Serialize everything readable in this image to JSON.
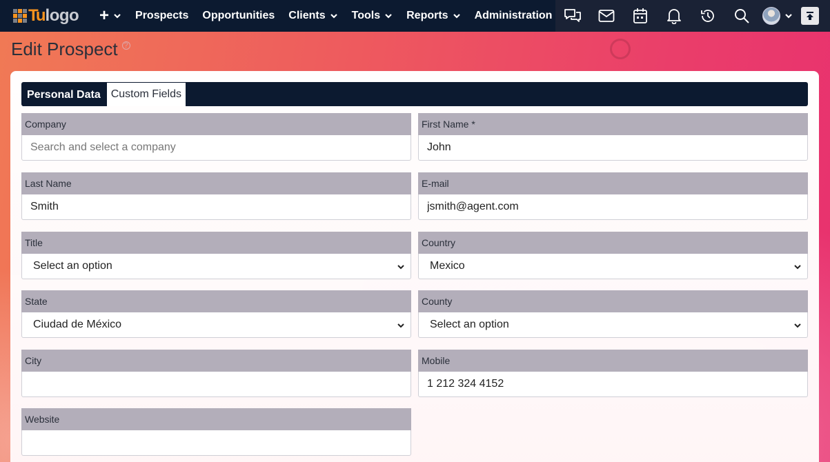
{
  "brand": {
    "logo_prefix": "Tu",
    "logo_text": "logo"
  },
  "nav": {
    "plus_label": "+",
    "items": [
      {
        "label": "Prospects",
        "has_menu": false
      },
      {
        "label": "Opportunities",
        "has_menu": false
      },
      {
        "label": "Clients",
        "has_menu": true
      },
      {
        "label": "Tools",
        "has_menu": true
      },
      {
        "label": "Reports",
        "has_menu": true
      },
      {
        "label": "Administration",
        "has_menu": true
      }
    ],
    "icons": [
      "chat-icon",
      "mail-icon",
      "calendar-icon",
      "bell-icon",
      "history-icon",
      "search-icon",
      "avatar",
      "scroll-top-icon"
    ]
  },
  "page": {
    "title": "Edit Prospect"
  },
  "tabs": [
    {
      "label": "Personal Data",
      "active": true
    },
    {
      "label": "Custom Fields",
      "active": false
    }
  ],
  "form": {
    "company": {
      "label": "Company",
      "value": "",
      "placeholder": "Search and select a company"
    },
    "first_name": {
      "label": "First Name *",
      "value": "John"
    },
    "last_name": {
      "label": "Last Name",
      "value": "Smith"
    },
    "email": {
      "label": "E-mail",
      "value": "jsmith@agent.com"
    },
    "title": {
      "label": "Title",
      "value": "Select an option"
    },
    "country": {
      "label": "Country",
      "value": "Mexico"
    },
    "state": {
      "label": "State",
      "value": "Ciudad de México"
    },
    "county": {
      "label": "County",
      "value": "Select an option"
    },
    "city": {
      "label": "City",
      "value": ""
    },
    "mobile": {
      "label": "Mobile",
      "value": "1 212 324 4152"
    },
    "website": {
      "label": "Website",
      "value": ""
    }
  },
  "colors": {
    "nav_bg": "#0c1a30",
    "nav_right_bg": "#1a2235",
    "label_bg": "#b3aeba",
    "logo_accent": "#f7931e"
  }
}
